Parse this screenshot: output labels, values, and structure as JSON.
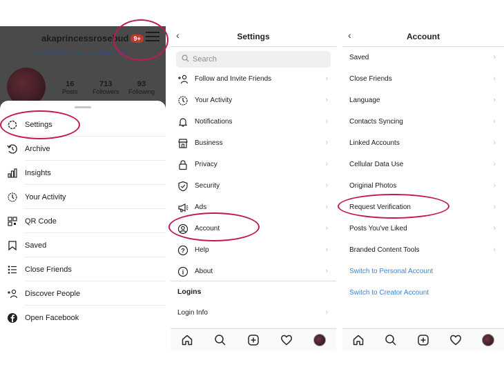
{
  "profile_panel": {
    "username": "akaprincessrosebud",
    "badge": "9+",
    "covid_link": "• See COVID-19 Business Resources",
    "stats": [
      {
        "number": "16",
        "label": "Posts"
      },
      {
        "number": "713",
        "label": "Followers"
      },
      {
        "number": "93",
        "label": "Following"
      }
    ],
    "menu": [
      {
        "label": "Settings",
        "icon": "gear-icon"
      },
      {
        "label": "Archive",
        "icon": "archive-icon"
      },
      {
        "label": "Insights",
        "icon": "insights-icon"
      },
      {
        "label": "Your Activity",
        "icon": "activity-icon"
      },
      {
        "label": "QR Code",
        "icon": "qr-code-icon"
      },
      {
        "label": "Saved",
        "icon": "bookmark-icon"
      },
      {
        "label": "Close Friends",
        "icon": "close-friends-icon"
      },
      {
        "label": "Discover People",
        "icon": "add-person-icon"
      },
      {
        "label": "Open Facebook",
        "icon": "facebook-icon"
      }
    ]
  },
  "settings_panel": {
    "title": "Settings",
    "search_placeholder": "Search",
    "items": [
      {
        "label": "Follow and Invite Friends",
        "icon": "add-person-icon"
      },
      {
        "label": "Your Activity",
        "icon": "activity-icon"
      },
      {
        "label": "Notifications",
        "icon": "bell-icon"
      },
      {
        "label": "Business",
        "icon": "store-icon"
      },
      {
        "label": "Privacy",
        "icon": "lock-icon"
      },
      {
        "label": "Security",
        "icon": "shield-icon"
      },
      {
        "label": "Ads",
        "icon": "megaphone-icon"
      },
      {
        "label": "Account",
        "icon": "account-icon"
      },
      {
        "label": "Help",
        "icon": "help-icon"
      },
      {
        "label": "About",
        "icon": "info-icon"
      }
    ],
    "logins_header": "Logins",
    "login_info": "Login Info"
  },
  "account_panel": {
    "title": "Account",
    "items": [
      {
        "label": "Saved"
      },
      {
        "label": "Close Friends"
      },
      {
        "label": "Language"
      },
      {
        "label": "Contacts Syncing"
      },
      {
        "label": "Linked Accounts"
      },
      {
        "label": "Cellular Data Use"
      },
      {
        "label": "Original Photos"
      },
      {
        "label": "Request Verification"
      },
      {
        "label": "Posts You've Liked"
      },
      {
        "label": "Branded Content Tools"
      }
    ],
    "links": [
      {
        "label": "Switch to Personal Account"
      },
      {
        "label": "Switch to Creator Account"
      }
    ]
  },
  "chevron": "›",
  "back": "‹",
  "colors": {
    "annotation": "#c2185b",
    "link": "#3a84d9",
    "badge": "#c0392b"
  }
}
